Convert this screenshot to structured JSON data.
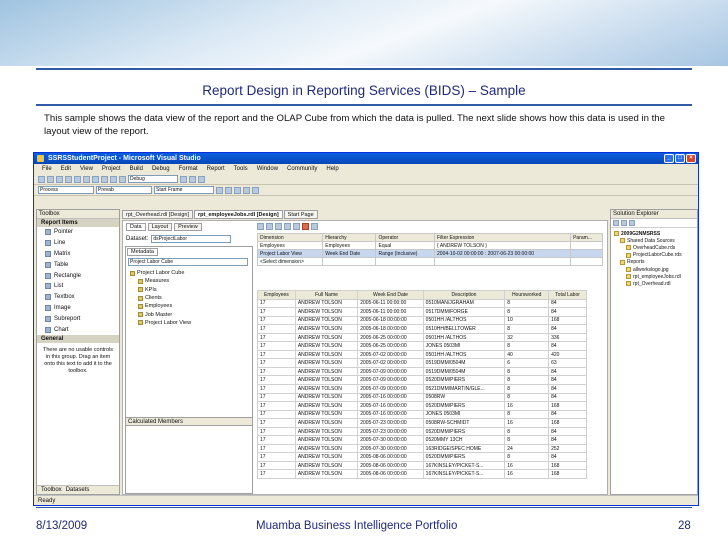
{
  "slide": {
    "title": "Report Design in Reporting Services (BIDS) – Sample",
    "intro": "This sample shows the data view of the report and the OLAP Cube from which the data is pulled. The next slide shows how  this data is used  in the layout view of the report.",
    "footer_date": "8/13/2009",
    "footer_center": "Muamba Business Intelligence Portfolio",
    "footer_page": "28"
  },
  "app": {
    "window_title": "SSRSStudentProject - Microsoft Visual Studio",
    "menu": [
      "File",
      "Edit",
      "View",
      "Project",
      "Build",
      "Debug",
      "Format",
      "Report",
      "Tools",
      "Window",
      "Community",
      "Help"
    ],
    "debug_combo": "Debug",
    "toolbar_combos": [
      "Process",
      "Prevab",
      "Start Frame"
    ],
    "toolbox": {
      "title": "Toolbox",
      "section": "Report Items",
      "items": [
        "Pointer",
        "Line",
        "Matrix",
        "Table",
        "Rectangle",
        "List",
        "Textbox",
        "Image",
        "Subreport",
        "Chart"
      ],
      "general": "General",
      "empty_text": "There are no usable controls in this group. Drag an item onto this text to add it to the toolbox.",
      "bottom_tabs": [
        "Toolbox",
        "Datasets"
      ]
    },
    "doc_tabs": [
      "rpt_Overhead.rdl [Design]",
      "rpt_employeeJobs.rdl [Design]",
      "Start Page"
    ],
    "view_tabs": [
      "Data",
      "Layout",
      "Preview"
    ],
    "dataset_label": "Dataset:",
    "dataset_value": "dsProjectLabor",
    "metadata_tab": "Metadata",
    "cube_combo": "Project Labor Cube",
    "cube_tree": [
      "Project Labor Cube",
      "Measures",
      "KPIs",
      "Clients",
      "Employees",
      "Job Master",
      "Project Labor View"
    ],
    "calculated_members": "Calculated Members",
    "filter": {
      "headers": [
        "Dimension",
        "Hierarchy",
        "Operator",
        "Filter Expression",
        "Param..."
      ],
      "rows": [
        [
          "Employees",
          "Employees",
          "Equal",
          "{ ANDREW TOLSON }",
          ""
        ],
        [
          "Project Labor View",
          "Week End Date",
          "Range (Inclusive)",
          "2004-10-02 00:00:00 : 2007-06-23 00:00:00",
          ""
        ],
        [
          "<Select dimension>",
          "",
          "",
          "",
          ""
        ]
      ]
    },
    "data_table": {
      "headers": [
        "Employees",
        "Full Name",
        "Week End Date",
        "Description",
        "Hoursworked",
        "Total Labor"
      ],
      "rows": [
        [
          "17",
          "ANDREW TOLSON",
          "2005-06-11 00:00:00",
          "0510MAN/JGRAHAM",
          "8",
          "84"
        ],
        [
          "17",
          "ANDREW TOLSON",
          "2005-06-11 00:00:00",
          "0517DMM/FORGE",
          "8",
          "84"
        ],
        [
          "17",
          "ANDREW TOLSON",
          "2005-06-18 00:00:00",
          "0501HH /ALTHOS",
          "10",
          "168"
        ],
        [
          "17",
          "ANDREW TOLSON",
          "2005-06-18 00:00:00",
          "0510HH/BELLTOWER",
          "8",
          "84"
        ],
        [
          "17",
          "ANDREW TOLSON",
          "2005-06-25 00:00:00",
          "0501HH /ALTHOS",
          "32",
          "336"
        ],
        [
          "17",
          "ANDREW TOLSON",
          "2005-06-25 00:00:00",
          "JONES 0503MI",
          "8",
          "84"
        ],
        [
          "17",
          "ANDREW TOLSON",
          "2005-07-02 00:00:00",
          "0501HH /ALTHOS",
          "40",
          "420"
        ],
        [
          "17",
          "ANDREW TOLSON",
          "2005-07-02 00:00:00",
          "0519DMM/0504M",
          "6",
          "63"
        ],
        [
          "17",
          "ANDREW TOLSON",
          "2005-07-09 00:00:00",
          "0519DMM/0504M",
          "8",
          "84"
        ],
        [
          "17",
          "ANDREW TOLSON",
          "2005-07-09 00:00:00",
          "0520DMM/PIERS",
          "8",
          "84"
        ],
        [
          "17",
          "ANDREW TOLSON",
          "2005-07-09 00:00:00",
          "0521DMM/MARTIN/GLE...",
          "8",
          "84"
        ],
        [
          "17",
          "ANDREW TOLSON",
          "2005-07-16 00:00:00",
          "0508RW",
          "8",
          "84"
        ],
        [
          "17",
          "ANDREW TOLSON",
          "2005-07-16 00:00:00",
          "0520DMM/PIERS",
          "16",
          "168"
        ],
        [
          "17",
          "ANDREW TOLSON",
          "2005-07-16 00:00:00",
          "JONES 0503MI",
          "8",
          "84"
        ],
        [
          "17",
          "ANDREW TOLSON",
          "2005-07-23 00:00:00",
          "0508RW-SCHMIDT",
          "16",
          "168"
        ],
        [
          "17",
          "ANDREW TOLSON",
          "2005-07-23 00:00:00",
          "0520DMM/PIERS",
          "8",
          "84"
        ],
        [
          "17",
          "ANDREW TOLSON",
          "2005-07-30 00:00:00",
          "0520MMY 13CH",
          "8",
          "84"
        ],
        [
          "17",
          "ANDREW TOLSON",
          "2005-07-30 00:00:00",
          "163RIDGE/SPEC HOME",
          "24",
          "252"
        ],
        [
          "17",
          "ANDREW TOLSON",
          "2005-08-06 00:00:00",
          "0520DMM/PIERS",
          "8",
          "84"
        ],
        [
          "17",
          "ANDREW TOLSON",
          "2005-08-06 00:00:00",
          "167KINSLEY/PICKET-S...",
          "16",
          "168"
        ],
        [
          "17",
          "ANDREW TOLSON",
          "2005-08-06 00:00:00",
          "167KINSLEY/PICKET-S...",
          "16",
          "168"
        ]
      ]
    },
    "solution_explorer": {
      "title": "Solution Explorer",
      "items": [
        "2009G2NMSRSS",
        "Shared Data Sources",
        "OverheadCube.rds",
        "ProjectLaborCube.rds",
        "Reports",
        "alĺworkslogo.jpg",
        "rpt_employeeJobs.rdl",
        "rpt_Overhead.rdl"
      ]
    },
    "status": "Ready"
  }
}
